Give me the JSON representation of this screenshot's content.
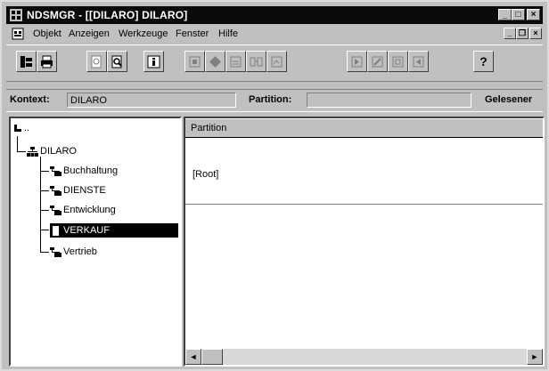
{
  "window": {
    "title": "NDSMGR - [[DILARO] DILARO]"
  },
  "title_buttons": {
    "minimize": "_",
    "maximize": "□",
    "close": "×"
  },
  "menu": {
    "items": [
      {
        "label": "Objekt"
      },
      {
        "label": "Anzeigen"
      },
      {
        "label": "Werkzeuge"
      },
      {
        "label": "Fenster"
      },
      {
        "label": "Hilfe"
      }
    ]
  },
  "mdi_buttons": {
    "minimize": "_",
    "restore": "❐",
    "close": "×"
  },
  "toolbar": {
    "help_label": "?"
  },
  "context": {
    "kontext_label": "Kontext:",
    "kontext_value": "DILARO",
    "partition_label": "Partition:",
    "partition_value": "",
    "gelesener_label": "Gelesener"
  },
  "tree": {
    "root": "..",
    "org": "DILARO",
    "children": [
      {
        "label": "Buchhaltung"
      },
      {
        "label": "DIENSTE"
      },
      {
        "label": "Entwicklung"
      },
      {
        "label": "VERKAUF",
        "selected": true
      },
      {
        "label": "Vertrieb"
      }
    ]
  },
  "list": {
    "column_header": "Partition",
    "rows": [
      "[Root]"
    ]
  },
  "scroll": {
    "left_arrow": "◄",
    "right_arrow": "►"
  }
}
